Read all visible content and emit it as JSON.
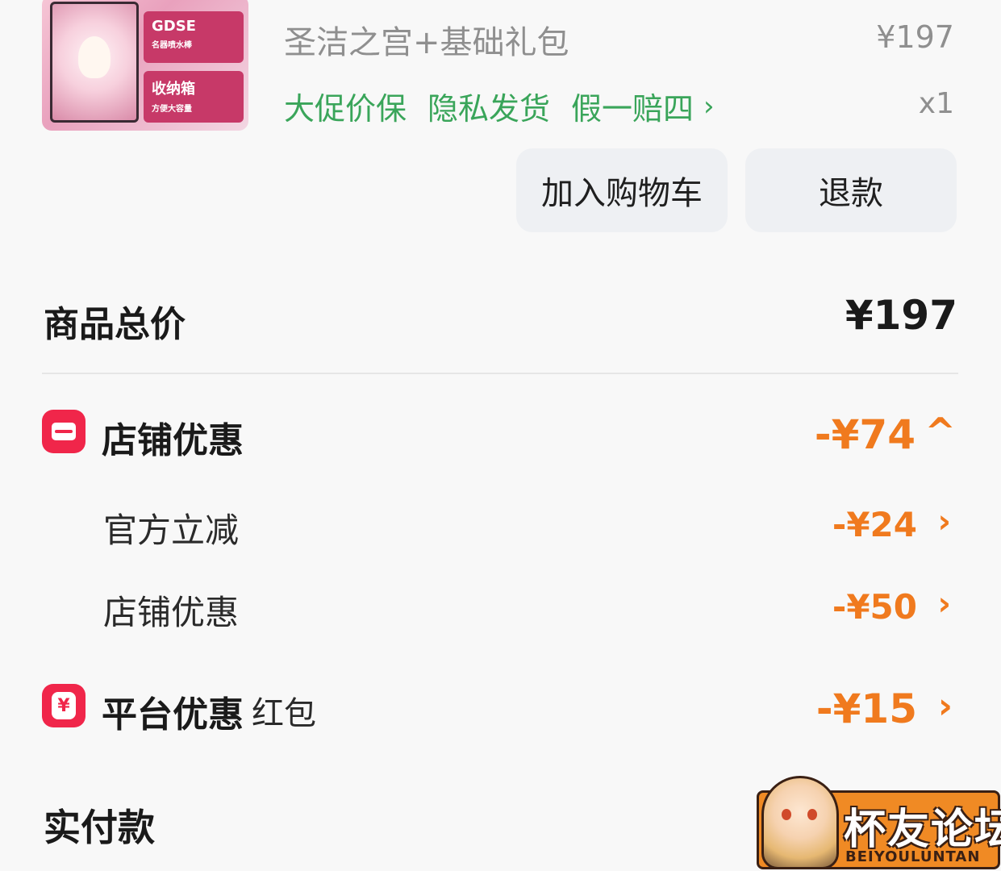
{
  "product": {
    "title": "圣洁之宫+基础礼包",
    "price": "¥197",
    "quantity": "x1",
    "tags": [
      "大促价保",
      "隐私发货",
      "假一赔四"
    ],
    "tag_arrow": "›",
    "thumb_cards": [
      {
        "line1": "GDSE",
        "line2": "名器喷水棒"
      },
      {
        "line1": "收纳箱",
        "line2": "方便大容量"
      }
    ]
  },
  "actions": {
    "add_to_cart": "加入购物车",
    "refund": "退款"
  },
  "summary": {
    "total_label": "商品总价",
    "total_value": "¥197",
    "shop_discount": {
      "label": "店铺优惠",
      "value": "-¥74",
      "chevron": "^",
      "items": [
        {
          "label": "官方立减",
          "value": "-¥24",
          "chevron": "›"
        },
        {
          "label": "店铺优惠",
          "value": "-¥50",
          "chevron": "›"
        }
      ]
    },
    "platform_discount": {
      "label": "平台优惠",
      "sub_label": "红包",
      "value": "-¥15",
      "chevron": "›",
      "badge_symbol": "¥"
    },
    "actual_payment_label": "实付款"
  },
  "watermark": {
    "title": "杯友论坛",
    "subtitle": "BEIYOULUNTAN"
  },
  "colors": {
    "accent_orange": "#f07a1e",
    "tag_green": "#3aa55a",
    "badge_red": "#f0264a"
  }
}
